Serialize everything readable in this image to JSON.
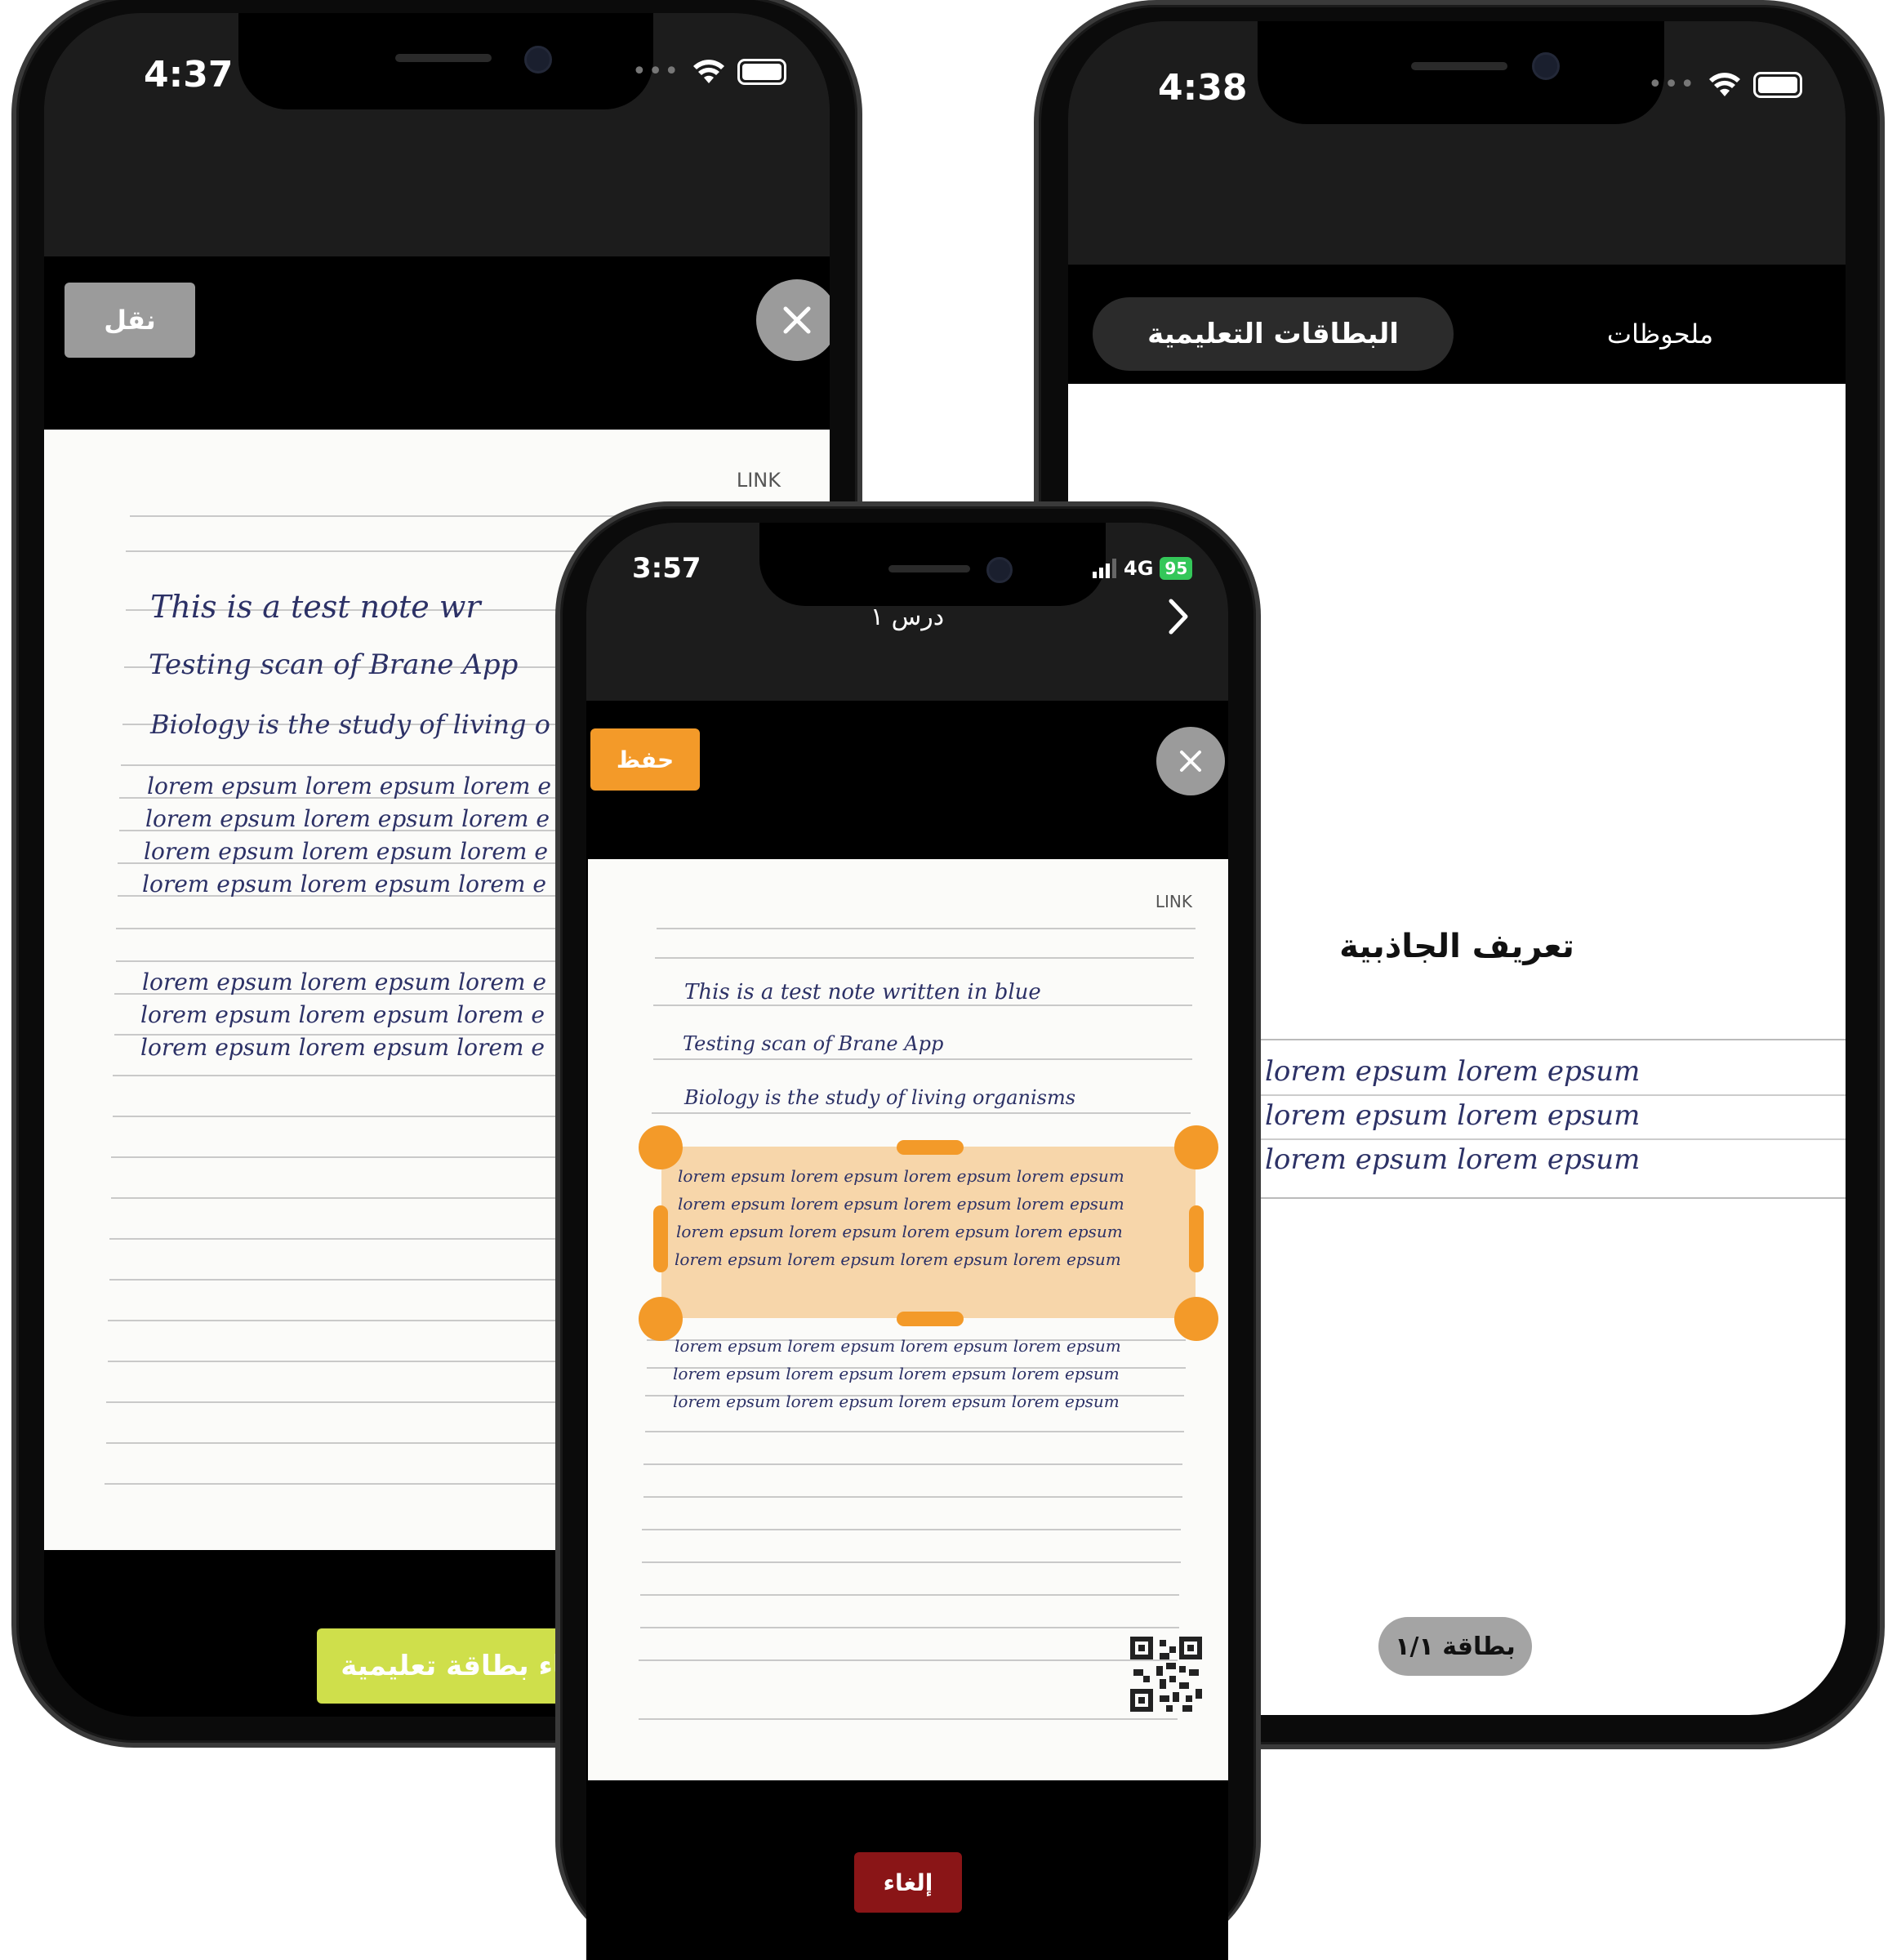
{
  "colors": {
    "orange": "#f39a29",
    "lime": "#cfdf4b",
    "dark_red": "#8a1517",
    "gray_button": "#9b9b9b",
    "selection": "#f7c992"
  },
  "left_phone": {
    "time": "4:37",
    "move_button": "نقل",
    "create_card_button": "إنشاء بطاقة تعليمية",
    "paper": {
      "label": "LINK",
      "lines": [
        "This is a test note wr",
        "Testing scan of Brane App",
        "Biology is the study of living o"
      ],
      "lorem_rows": [
        "lorem epsum lorem epsum lorem e",
        "lorem epsum lorem epsum lorem e",
        "lorem epsum lorem epsum lorem e",
        "lorem epsum lorem epsum lorem e"
      ],
      "lorem_rows_2": [
        "lorem epsum lorem epsum lorem e",
        "lorem epsum lorem epsum lorem e",
        "lorem epsum lorem epsum lorem e"
      ]
    }
  },
  "right_phone": {
    "time": "4:38",
    "tab_flashcards": "البطاقات التعليمية",
    "tab_notes": "ملحوظات",
    "card_title": "تعريف الجاذبية",
    "card_rows": [
      "lorem epsum lorem epsum lorem epsum",
      "lorem epsum lorem epsum lorem epsum",
      "lorem epsum lorem epsum lorem epsum"
    ],
    "card_counter": "بطاقة ١/١"
  },
  "center_phone": {
    "time": "3:57",
    "network": "4G",
    "battery": "95",
    "nav_title": "درس ١",
    "save_button": "حفظ",
    "cancel_button": "إلغاء",
    "paper": {
      "label": "LINK",
      "lines": [
        "This is a test note written in blue",
        "Testing scan of Brane App",
        "Biology is the study of living organisms"
      ],
      "selected_rows": [
        "lorem epsum lorem epsum lorem epsum lorem epsum",
        "lorem epsum lorem epsum lorem epsum lorem epsum",
        "lorem epsum lorem epsum lorem epsum lorem epsum",
        "lorem epsum lorem epsum lorem epsum lorem epsum"
      ],
      "rows_below": [
        "lorem epsum lorem epsum lorem epsum lorem epsum",
        "lorem epsum lorem epsum lorem epsum lorem epsum",
        "lorem epsum lorem epsum lorem epsum lorem epsum"
      ]
    }
  }
}
